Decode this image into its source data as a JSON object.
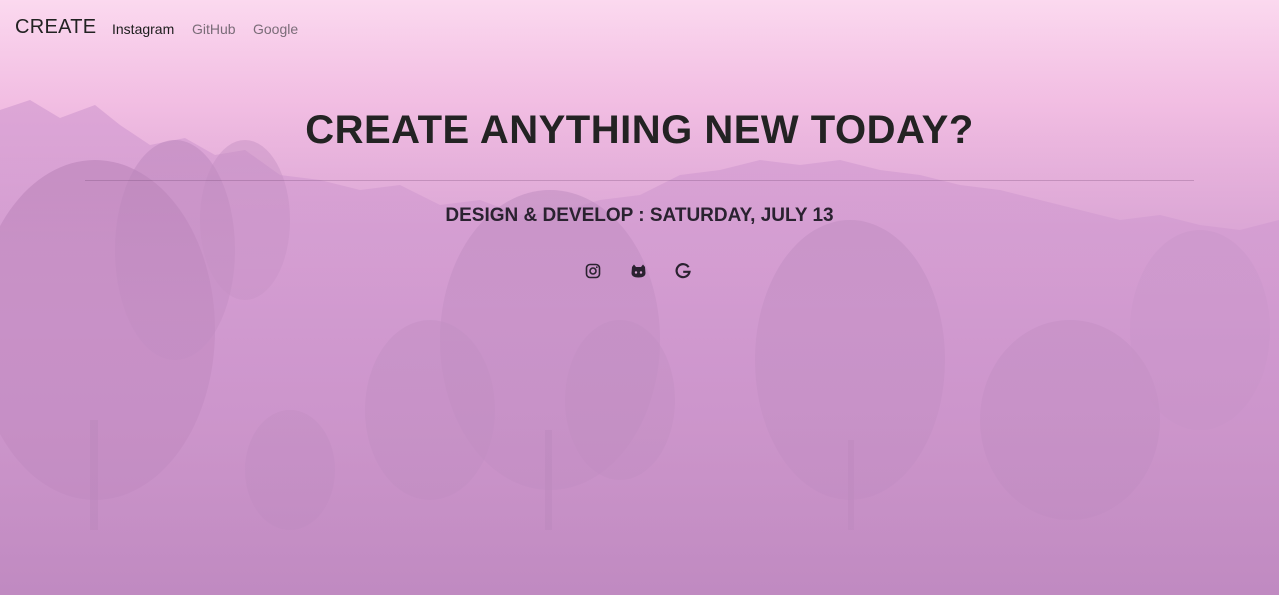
{
  "navbar": {
    "brand": "CREATE",
    "links": [
      {
        "label": "Instagram",
        "active": true
      },
      {
        "label": "GitHub",
        "active": false
      },
      {
        "label": "Google",
        "active": false
      }
    ]
  },
  "hero": {
    "title": "CREATE ANYTHING NEW TODAY?",
    "subtitle": "DESIGN & DEVELOP : SATURDAY, JULY 13"
  },
  "social_icons": [
    {
      "icon": "instagram-icon"
    },
    {
      "icon": "github-icon"
    },
    {
      "icon": "google-icon"
    }
  ],
  "colors": {
    "text_dark": "#232323",
    "nav_muted": "#7a6c78",
    "bg_top": "#fbd9ef",
    "bg_bottom": "#b983bb"
  }
}
